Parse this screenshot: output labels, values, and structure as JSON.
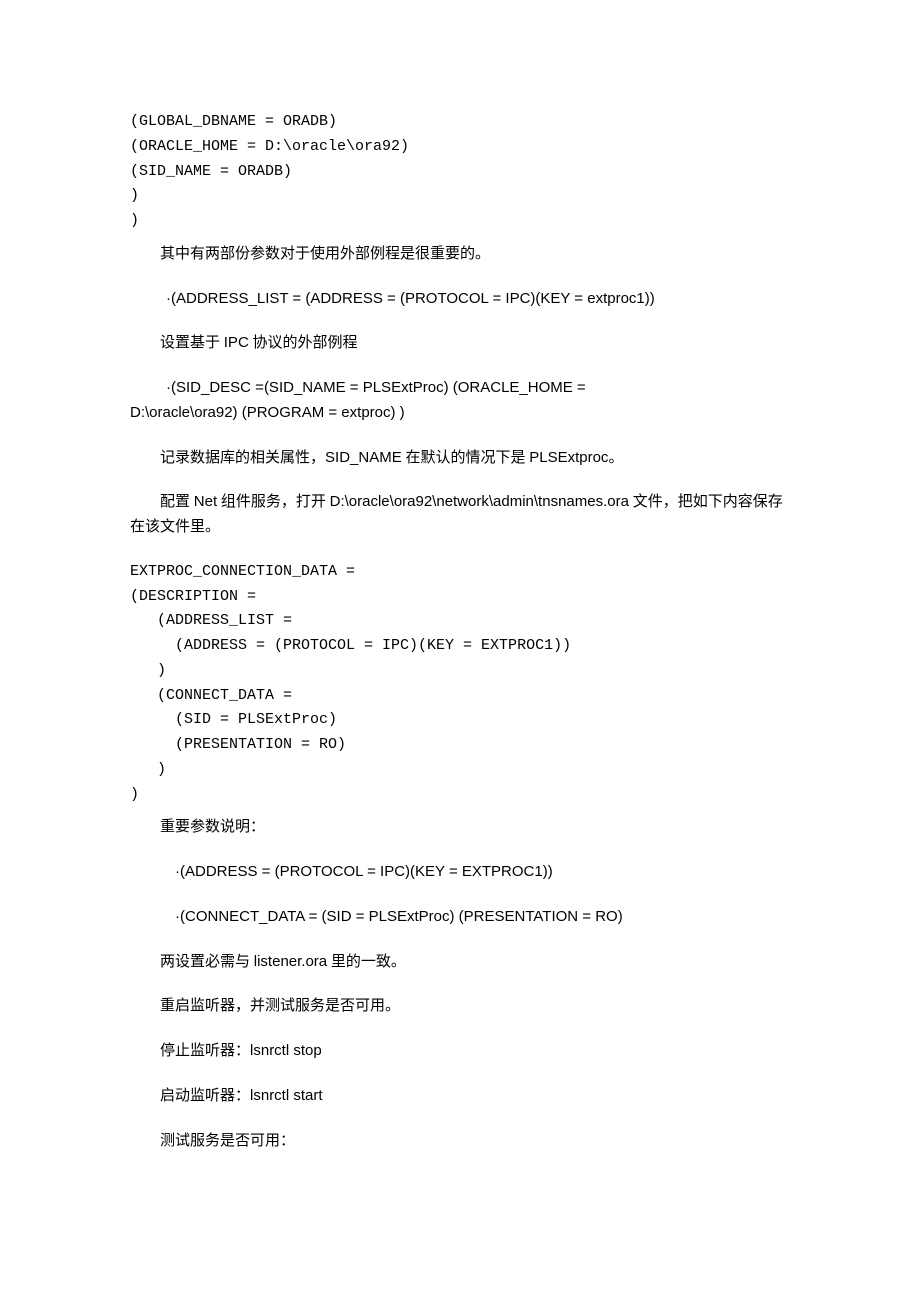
{
  "code1": {
    "l1": "(GLOBAL_DBNAME = ORADB)",
    "l2": "(ORACLE_HOME = D:\\oracle\\ora92)",
    "l3": "(SID_NAME = ORADB)",
    "l4": ")",
    "l5": ")"
  },
  "p1": "其中有两部份参数对于使用外部例程是很重要的。",
  "p2": "·(ADDRESS_LIST = (ADDRESS = (PROTOCOL = IPC)(KEY = extproc1))",
  "p3_pre": "设置基于 ",
  "p3_mid": "IPC",
  "p3_post": " 协议的外部例程",
  "p4a": "·(SID_DESC =(SID_NAME = PLSExtProc) (ORACLE_HOME = ",
  "p4b": "D:\\oracle\\ora92) (PROGRAM = extproc) )",
  "p5_pre": "记录数据库的相关属性，",
  "p5_mid": "SID_NAME",
  "p5_mid2": " 在默认的情况下是 ",
  "p5_end": "PLSExtproc",
  "p5_dot": "。",
  "p6_pre": "配置 ",
  "p6_net": "Net",
  "p6_mid": " 组件服务，打开 ",
  "p6_path": "D:\\oracle\\ora92\\network\\admin\\tnsnames.ora",
  "p6_post": " 文件，把如下内容保存在该文件里。",
  "code2": {
    "l1": "EXTPROC_CONNECTION_DATA =",
    "l2": "(DESCRIPTION =",
    "l3": "   (ADDRESS_LIST =",
    "l4": "     (ADDRESS = (PROTOCOL = IPC)(KEY = EXTPROC1))",
    "l5": "   )",
    "l6": "   (CONNECT_DATA =",
    "l7": "     (SID = PLSExtProc)",
    "l8": "     (PRESENTATION = RO)",
    "l9": "   )",
    "l10": ")"
  },
  "p7": "重要参数说明：",
  "p8": "·(ADDRESS = (PROTOCOL = IPC)(KEY = EXTPROC1))",
  "p9": "·(CONNECT_DATA = (SID = PLSExtProc) (PRESENTATION = RO)",
  "p10_pre": "两设置必需与 ",
  "p10_mid": "listener.ora",
  "p10_post": " 里的一致。",
  "p11": "重启监听器，并测试服务是否可用。",
  "p12_pre": "停止监听器：",
  "p12_cmd": "lsnrctl stop",
  "p13_pre": "启动监听器：",
  "p13_cmd": "lsnrctl start",
  "p14": "测试服务是否可用："
}
